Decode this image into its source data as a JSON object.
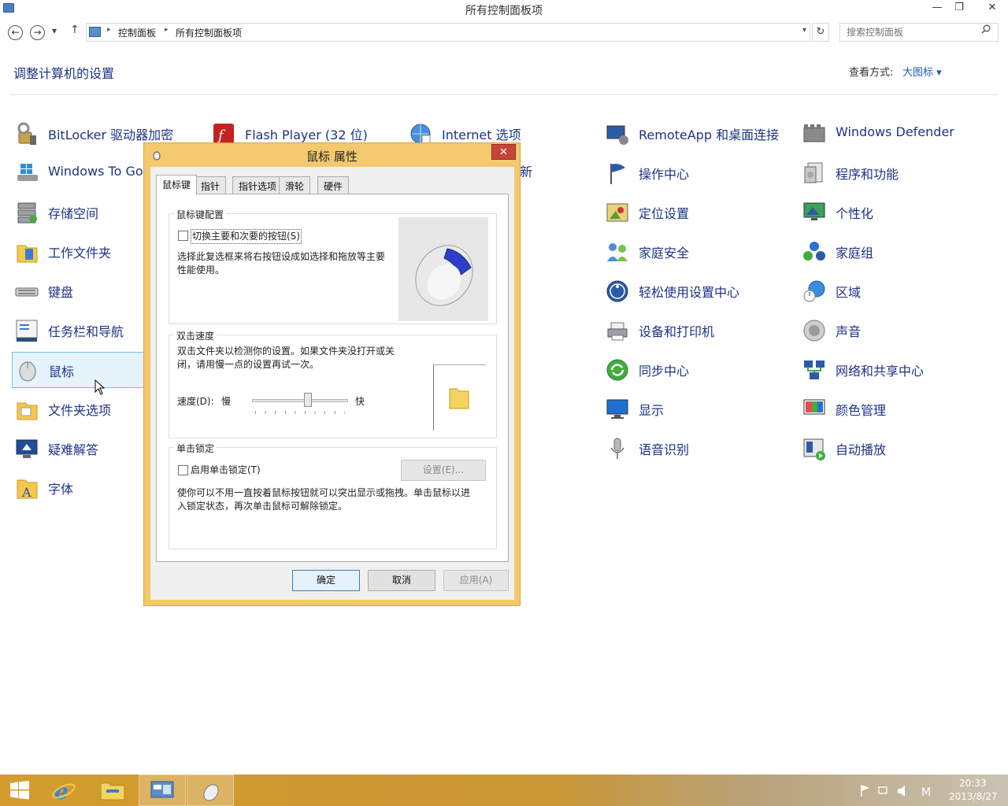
{
  "window": {
    "title": "所有控制面板项",
    "minimize": "—",
    "restore": "❐",
    "close": "✕"
  },
  "address_bar": {
    "back": "←",
    "forward": "→",
    "recent": "▾",
    "up": "↑",
    "crumbs": [
      "控制面板",
      "所有控制面板项"
    ],
    "crumb_sep": "▸",
    "dropdown": "▾",
    "refresh": "↻",
    "search_placeholder": "搜索控制面板"
  },
  "header": {
    "title": "调整计算机的设置",
    "view_label": "查看方式:",
    "view_value": "大图标 ▾"
  },
  "items": {
    "col1": [
      "BitLocker 驱动器加密",
      "Windows To Go",
      "存储空间",
      "工作文件夹",
      "键盘",
      "任务栏和导航",
      "鼠标",
      "文件夹选项",
      "疑难解答",
      "字体"
    ],
    "col2": [
      "Flash Player (32 位)"
    ],
    "col3": [
      "Internet 选项"
    ],
    "col3_partial": "新",
    "col4": [
      "RemoteApp 和桌面连接",
      "操作中心",
      "定位设置",
      "家庭安全",
      "轻松使用设置中心",
      "设备和打印机",
      "同步中心",
      "显示",
      "语音识别"
    ],
    "col5": [
      "Windows Defender",
      "程序和功能",
      "个性化",
      "家庭组",
      "区域",
      "声音",
      "网络和共享中心",
      "颜色管理",
      "自动播放"
    ]
  },
  "dialog": {
    "title": "鼠标 属性",
    "close": "✕",
    "tabs": [
      "鼠标键",
      "指针",
      "指针选项",
      "滑轮",
      "硬件"
    ],
    "button_config": {
      "title": "鼠标键配置",
      "switch_label": "切换主要和次要的按钮(S)",
      "description_line1": "选择此复选框来将右按钮设成如选择和拖放等主要",
      "description_line2": "性能使用。"
    },
    "double_click": {
      "title": "双击速度",
      "description_line1": "双击文件夹以检测你的设置。如果文件夹没打开或关",
      "description_line2": "闭，请用慢一点的设置再试一次。",
      "speed_label": "速度(D):",
      "slow": "慢",
      "fast": "快",
      "slider_value": 0.58
    },
    "click_lock": {
      "title": "单击锁定",
      "enable_label": "启用单击锁定(T)",
      "settings_button": "设置(E)...",
      "description_line1": "使你可以不用一直按着鼠标按钮就可以突出显示或拖拽。单击鼠标以进",
      "description_line2": "入锁定状态，再次单击鼠标可解除锁定。"
    },
    "ok": "确定",
    "cancel": "取消",
    "apply": "应用(A)"
  },
  "taskbar": {
    "time": "20:33",
    "date": "2013/8/27",
    "buttons": [
      "start-icon",
      "internet-explorer-icon",
      "file-explorer-icon",
      "control-panel-icon",
      "mouse-properties-icon"
    ]
  },
  "colors": {
    "link": "#1e3287",
    "dialog_frame": "#f3c86e",
    "taskbar": "#d49c2e"
  }
}
